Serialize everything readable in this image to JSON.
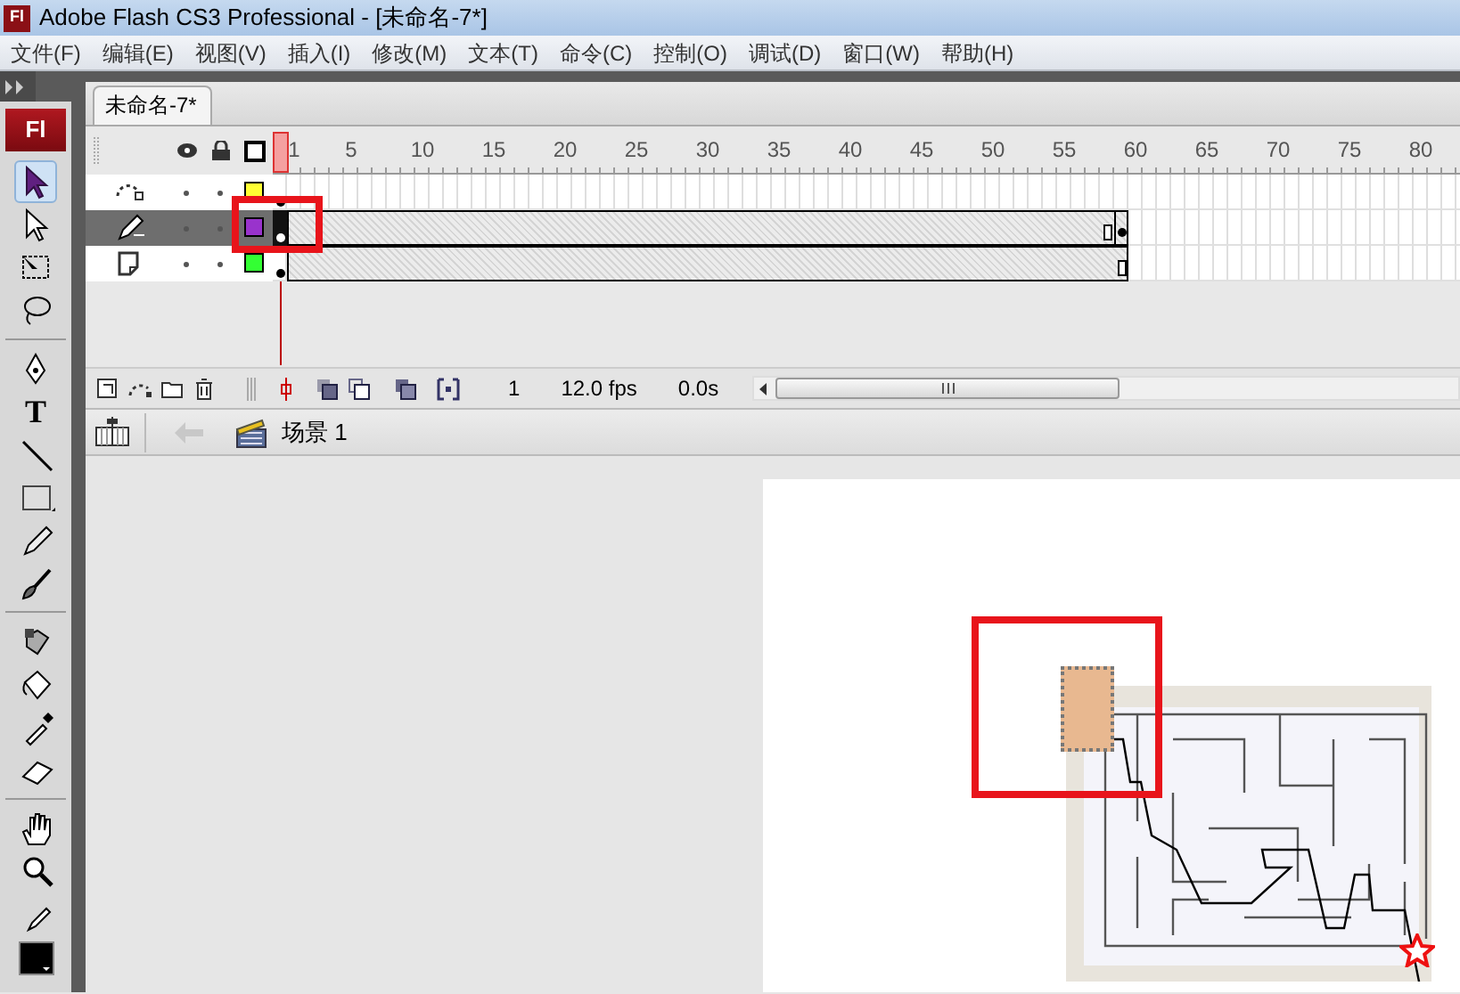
{
  "window": {
    "app_icon": "Fl",
    "title": "Adobe Flash CS3 Professional - [未命名-7*]"
  },
  "menu": [
    "文件(F)",
    "编辑(E)",
    "视图(V)",
    "插入(I)",
    "修改(M)",
    "文本(T)",
    "命令(C)",
    "控制(O)",
    "调试(D)",
    "窗口(W)",
    "帮助(H)"
  ],
  "tools_panel": {
    "logo": "Fl",
    "groups": [
      [
        {
          "kind": "arrow",
          "selected": true
        },
        {
          "kind": "subselect",
          "selected": false
        },
        {
          "kind": "transform",
          "selected": false
        },
        {
          "kind": "lasso",
          "selected": false
        }
      ],
      [
        {
          "kind": "pen",
          "selected": false
        },
        {
          "kind": "text",
          "label": "T",
          "selected": false
        },
        {
          "kind": "line",
          "selected": false
        },
        {
          "kind": "rect",
          "selected": false
        },
        {
          "kind": "pencil",
          "selected": false
        },
        {
          "kind": "brush",
          "selected": false
        }
      ],
      [
        {
          "kind": "inkbottle",
          "selected": false
        },
        {
          "kind": "bucket",
          "selected": false
        },
        {
          "kind": "dropper",
          "selected": false
        },
        {
          "kind": "eraser",
          "selected": false
        }
      ],
      [
        {
          "kind": "hand",
          "selected": false
        },
        {
          "kind": "zoom",
          "selected": false
        },
        {
          "kind": "stroke",
          "selected": false
        },
        {
          "kind": "fill",
          "selected": false
        }
      ]
    ]
  },
  "document_tab": {
    "label": "未命名-7*"
  },
  "timeline": {
    "frame_numbers": [
      "1",
      "5",
      "10",
      "15",
      "20",
      "25",
      "30",
      "35",
      "40",
      "45",
      "50",
      "55",
      "60",
      "65",
      "70",
      "75",
      "80"
    ],
    "layers": [
      {
        "kind": "guide",
        "selected": false,
        "color": "#ffff33"
      },
      {
        "kind": "guided",
        "selected": true,
        "color": "#9933cc",
        "end_keyframe": true
      },
      {
        "kind": "guided",
        "selected": false,
        "color": "#33ff33"
      }
    ],
    "current_frame": "1",
    "frame_rate": "12.0 fps",
    "elapsed": "0.0s"
  },
  "breadcrumb": {
    "scene": "场景 1"
  }
}
